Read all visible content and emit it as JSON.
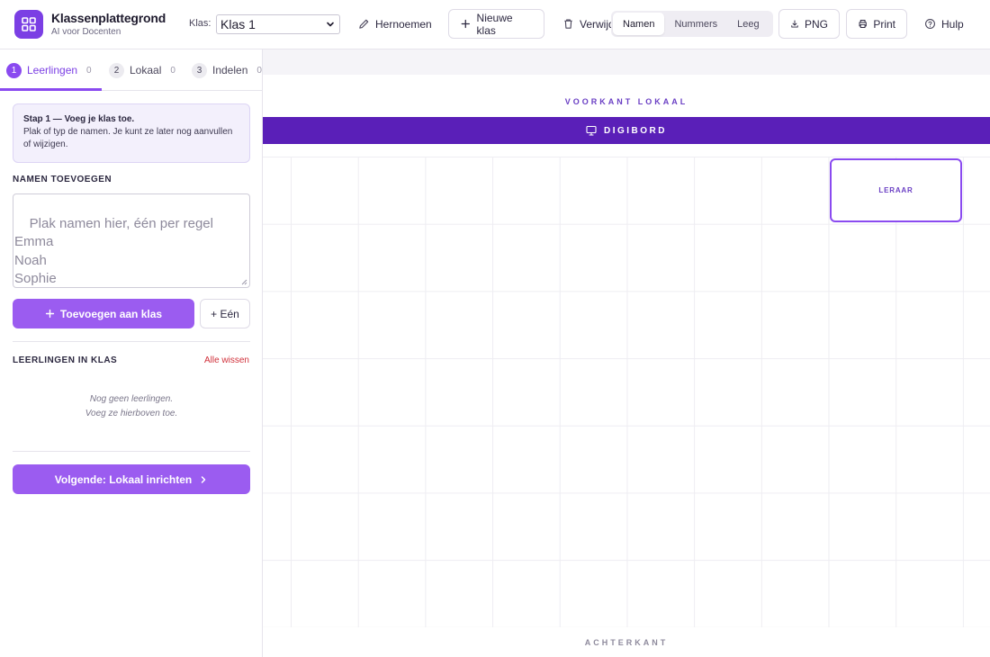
{
  "header": {
    "brand_title": "Klassenplattegrond",
    "brand_subtitle": "AI voor Docenten",
    "klas_label": "Klas:",
    "klas_selected": "Klas 1",
    "rename_label": "Hernoemen",
    "new_class_label": "Nieuwe klas",
    "delete_label": "Verwijd",
    "view_modes": [
      "Namen",
      "Nummers",
      "Leeg"
    ],
    "active_view_mode": "Namen",
    "png_label": "PNG",
    "print_label": "Print",
    "help_label": "Hulp"
  },
  "steps": [
    {
      "num": "1",
      "label": "Leerlingen",
      "count": "0"
    },
    {
      "num": "2",
      "label": "Lokaal",
      "count": "0"
    },
    {
      "num": "3",
      "label": "Indelen",
      "count": "0"
    }
  ],
  "info": {
    "title": "Stap 1 — Voeg je klas toe.",
    "text": "Plak of typ de namen. Je kunt ze later nog aanvullen of wijzigen."
  },
  "add_names": {
    "heading": "NAMEN TOEVOEGEN",
    "placeholder": "Plak namen hier, één per regel\nEmma\nNoah\nSophie\n…",
    "add_button": "Toevoegen aan klas",
    "one_button": "+ Eén"
  },
  "students": {
    "heading": "LEERLINGEN IN KLAS",
    "clear_link": "Alle wissen",
    "empty_line1": "Nog geen leerlingen.",
    "empty_line2": "Voeg ze hierboven toe."
  },
  "next_button": "Volgende: Lokaal inrichten",
  "canvas": {
    "front_label": "VOORKANT LOKAAL",
    "board_label": "DIGIBORD",
    "teacher_label": "LERAAR",
    "back_label": "ACHTERKANT"
  },
  "colors": {
    "accent": "#8a4af0",
    "board": "#5a1fb8",
    "danger": "#d0303a"
  }
}
